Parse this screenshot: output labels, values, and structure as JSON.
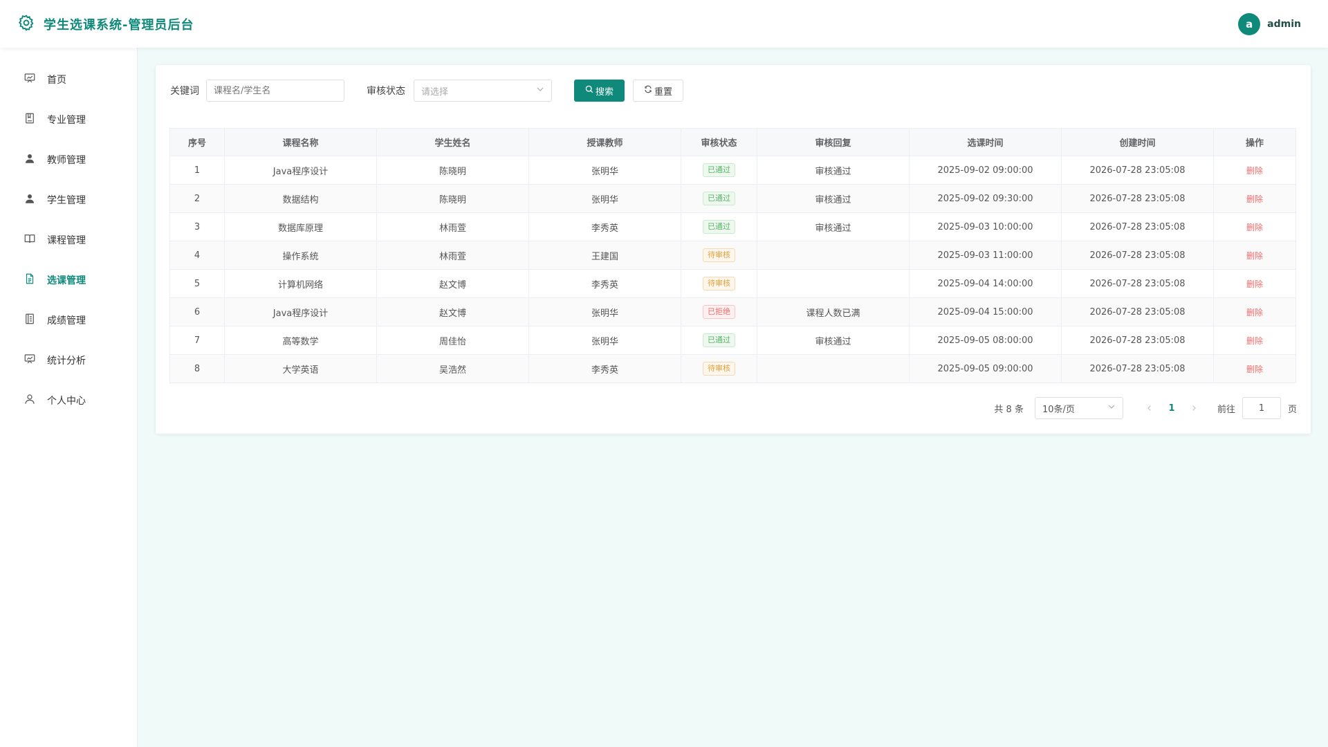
{
  "app": {
    "title": "学生选课系统-管理员后台"
  },
  "user": {
    "avatar_letter": "a",
    "name": "admin"
  },
  "sidebar": {
    "items": [
      {
        "label": "首页",
        "icon": "dashboard-icon"
      },
      {
        "label": "专业管理",
        "icon": "book-icon"
      },
      {
        "label": "教师管理",
        "icon": "user-solid-icon"
      },
      {
        "label": "学生管理",
        "icon": "user-solid-icon"
      },
      {
        "label": "课程管理",
        "icon": "open-book-icon"
      },
      {
        "label": "选课管理",
        "icon": "document-icon",
        "active": true
      },
      {
        "label": "成绩管理",
        "icon": "notebook-icon"
      },
      {
        "label": "统计分析",
        "icon": "chart-icon"
      },
      {
        "label": "个人中心",
        "icon": "user-outline-icon"
      }
    ]
  },
  "filters": {
    "keyword_label": "关键词",
    "keyword_placeholder": "课程名/学生名",
    "status_label": "审核状态",
    "status_placeholder": "请选择",
    "search_label": "搜索",
    "reset_label": "重置"
  },
  "table": {
    "headers": [
      "序号",
      "课程名称",
      "学生姓名",
      "授课教师",
      "审核状态",
      "审核回复",
      "选课时间",
      "创建时间",
      "操作"
    ],
    "rows": [
      {
        "no": "1",
        "course": "Java程序设计",
        "student": "陈晓明",
        "teacher": "张明华",
        "status": "已通过",
        "status_type": "approved",
        "reply": "审核通过",
        "select_time": "2025-09-02 09:00:00",
        "created": "2026-07-28 23:05:08",
        "action": "删除"
      },
      {
        "no": "2",
        "course": "数据结构",
        "student": "陈晓明",
        "teacher": "张明华",
        "status": "已通过",
        "status_type": "approved",
        "reply": "审核通过",
        "select_time": "2025-09-02 09:30:00",
        "created": "2026-07-28 23:05:08",
        "action": "删除"
      },
      {
        "no": "3",
        "course": "数据库原理",
        "student": "林雨萱",
        "teacher": "李秀英",
        "status": "已通过",
        "status_type": "approved",
        "reply": "审核通过",
        "select_time": "2025-09-03 10:00:00",
        "created": "2026-07-28 23:05:08",
        "action": "删除"
      },
      {
        "no": "4",
        "course": "操作系统",
        "student": "林雨萱",
        "teacher": "王建国",
        "status": "待审核",
        "status_type": "pending",
        "reply": "",
        "select_time": "2025-09-03 11:00:00",
        "created": "2026-07-28 23:05:08",
        "action": "删除"
      },
      {
        "no": "5",
        "course": "计算机网络",
        "student": "赵文博",
        "teacher": "李秀英",
        "status": "待审核",
        "status_type": "pending",
        "reply": "",
        "select_time": "2025-09-04 14:00:00",
        "created": "2026-07-28 23:05:08",
        "action": "删除"
      },
      {
        "no": "6",
        "course": "Java程序设计",
        "student": "赵文博",
        "teacher": "张明华",
        "status": "已拒绝",
        "status_type": "rejected",
        "reply": "课程人数已满",
        "select_time": "2025-09-04 15:00:00",
        "created": "2026-07-28 23:05:08",
        "action": "删除"
      },
      {
        "no": "7",
        "course": "高等数学",
        "student": "周佳怡",
        "teacher": "张明华",
        "status": "已通过",
        "status_type": "approved",
        "reply": "审核通过",
        "select_time": "2025-09-05 08:00:00",
        "created": "2026-07-28 23:05:08",
        "action": "删除"
      },
      {
        "no": "8",
        "course": "大学英语",
        "student": "吴浩然",
        "teacher": "李秀英",
        "status": "待审核",
        "status_type": "pending",
        "reply": "",
        "select_time": "2025-09-05 09:00:00",
        "created": "2026-07-28 23:05:08",
        "action": "删除"
      }
    ]
  },
  "pagination": {
    "total_text": "共 8 条",
    "page_size": "10条/页",
    "current_page": "1",
    "goto_label": "前往",
    "goto_value": "1",
    "page_suffix": "页"
  },
  "colors": {
    "brand": "#0f8a7a",
    "approved": "#59b46a",
    "pending": "#e6a23c",
    "rejected": "#f56c6c"
  }
}
